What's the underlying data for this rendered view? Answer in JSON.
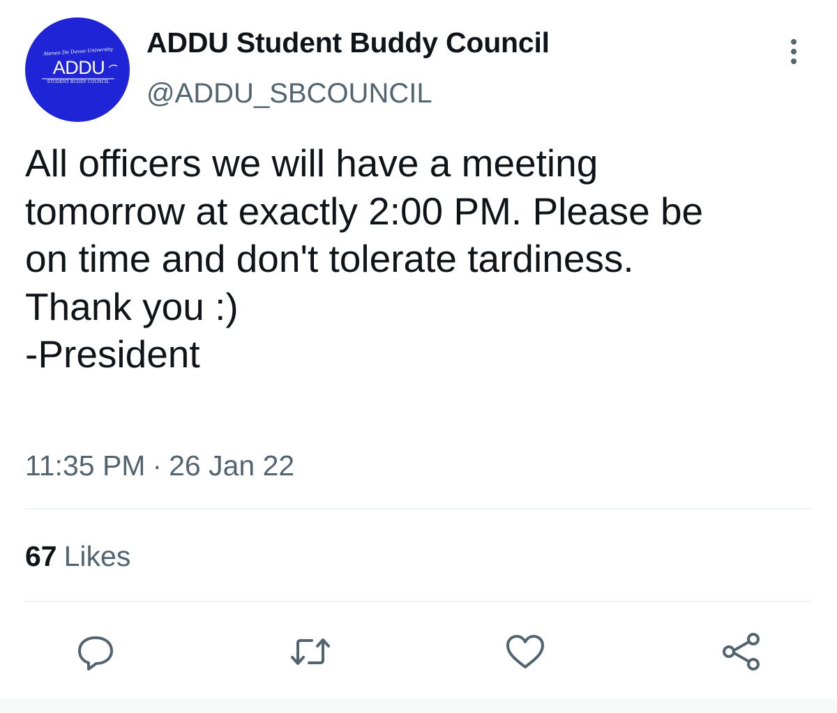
{
  "author": {
    "display_name": "ADDU Student Buddy Council",
    "handle": "@ADDU_SBCOUNCIL",
    "avatar": {
      "background_color": "#1f25d6",
      "top_text": "Ateneo De Davao University",
      "main_text": "ADDU",
      "bottom_text": "STUDENT BUDDY COUNCIL"
    }
  },
  "tweet": {
    "lines": [
      "All officers we will have a meeting",
      "tomorrow at exactly 2:00 PM. Please be",
      "on time and don't tolerate tardiness.",
      "Thank you :)",
      "-President"
    ],
    "time": "11:35 PM",
    "separator": "·",
    "date": "26 Jan 22"
  },
  "stats": {
    "likes_count": "67",
    "likes_label": "Likes"
  },
  "actions": {
    "icons": [
      "reply-icon",
      "retweet-icon",
      "like-icon",
      "share-icon"
    ],
    "icon_color": "#536471"
  },
  "menu": {
    "icon": "more-vertical-icon"
  }
}
